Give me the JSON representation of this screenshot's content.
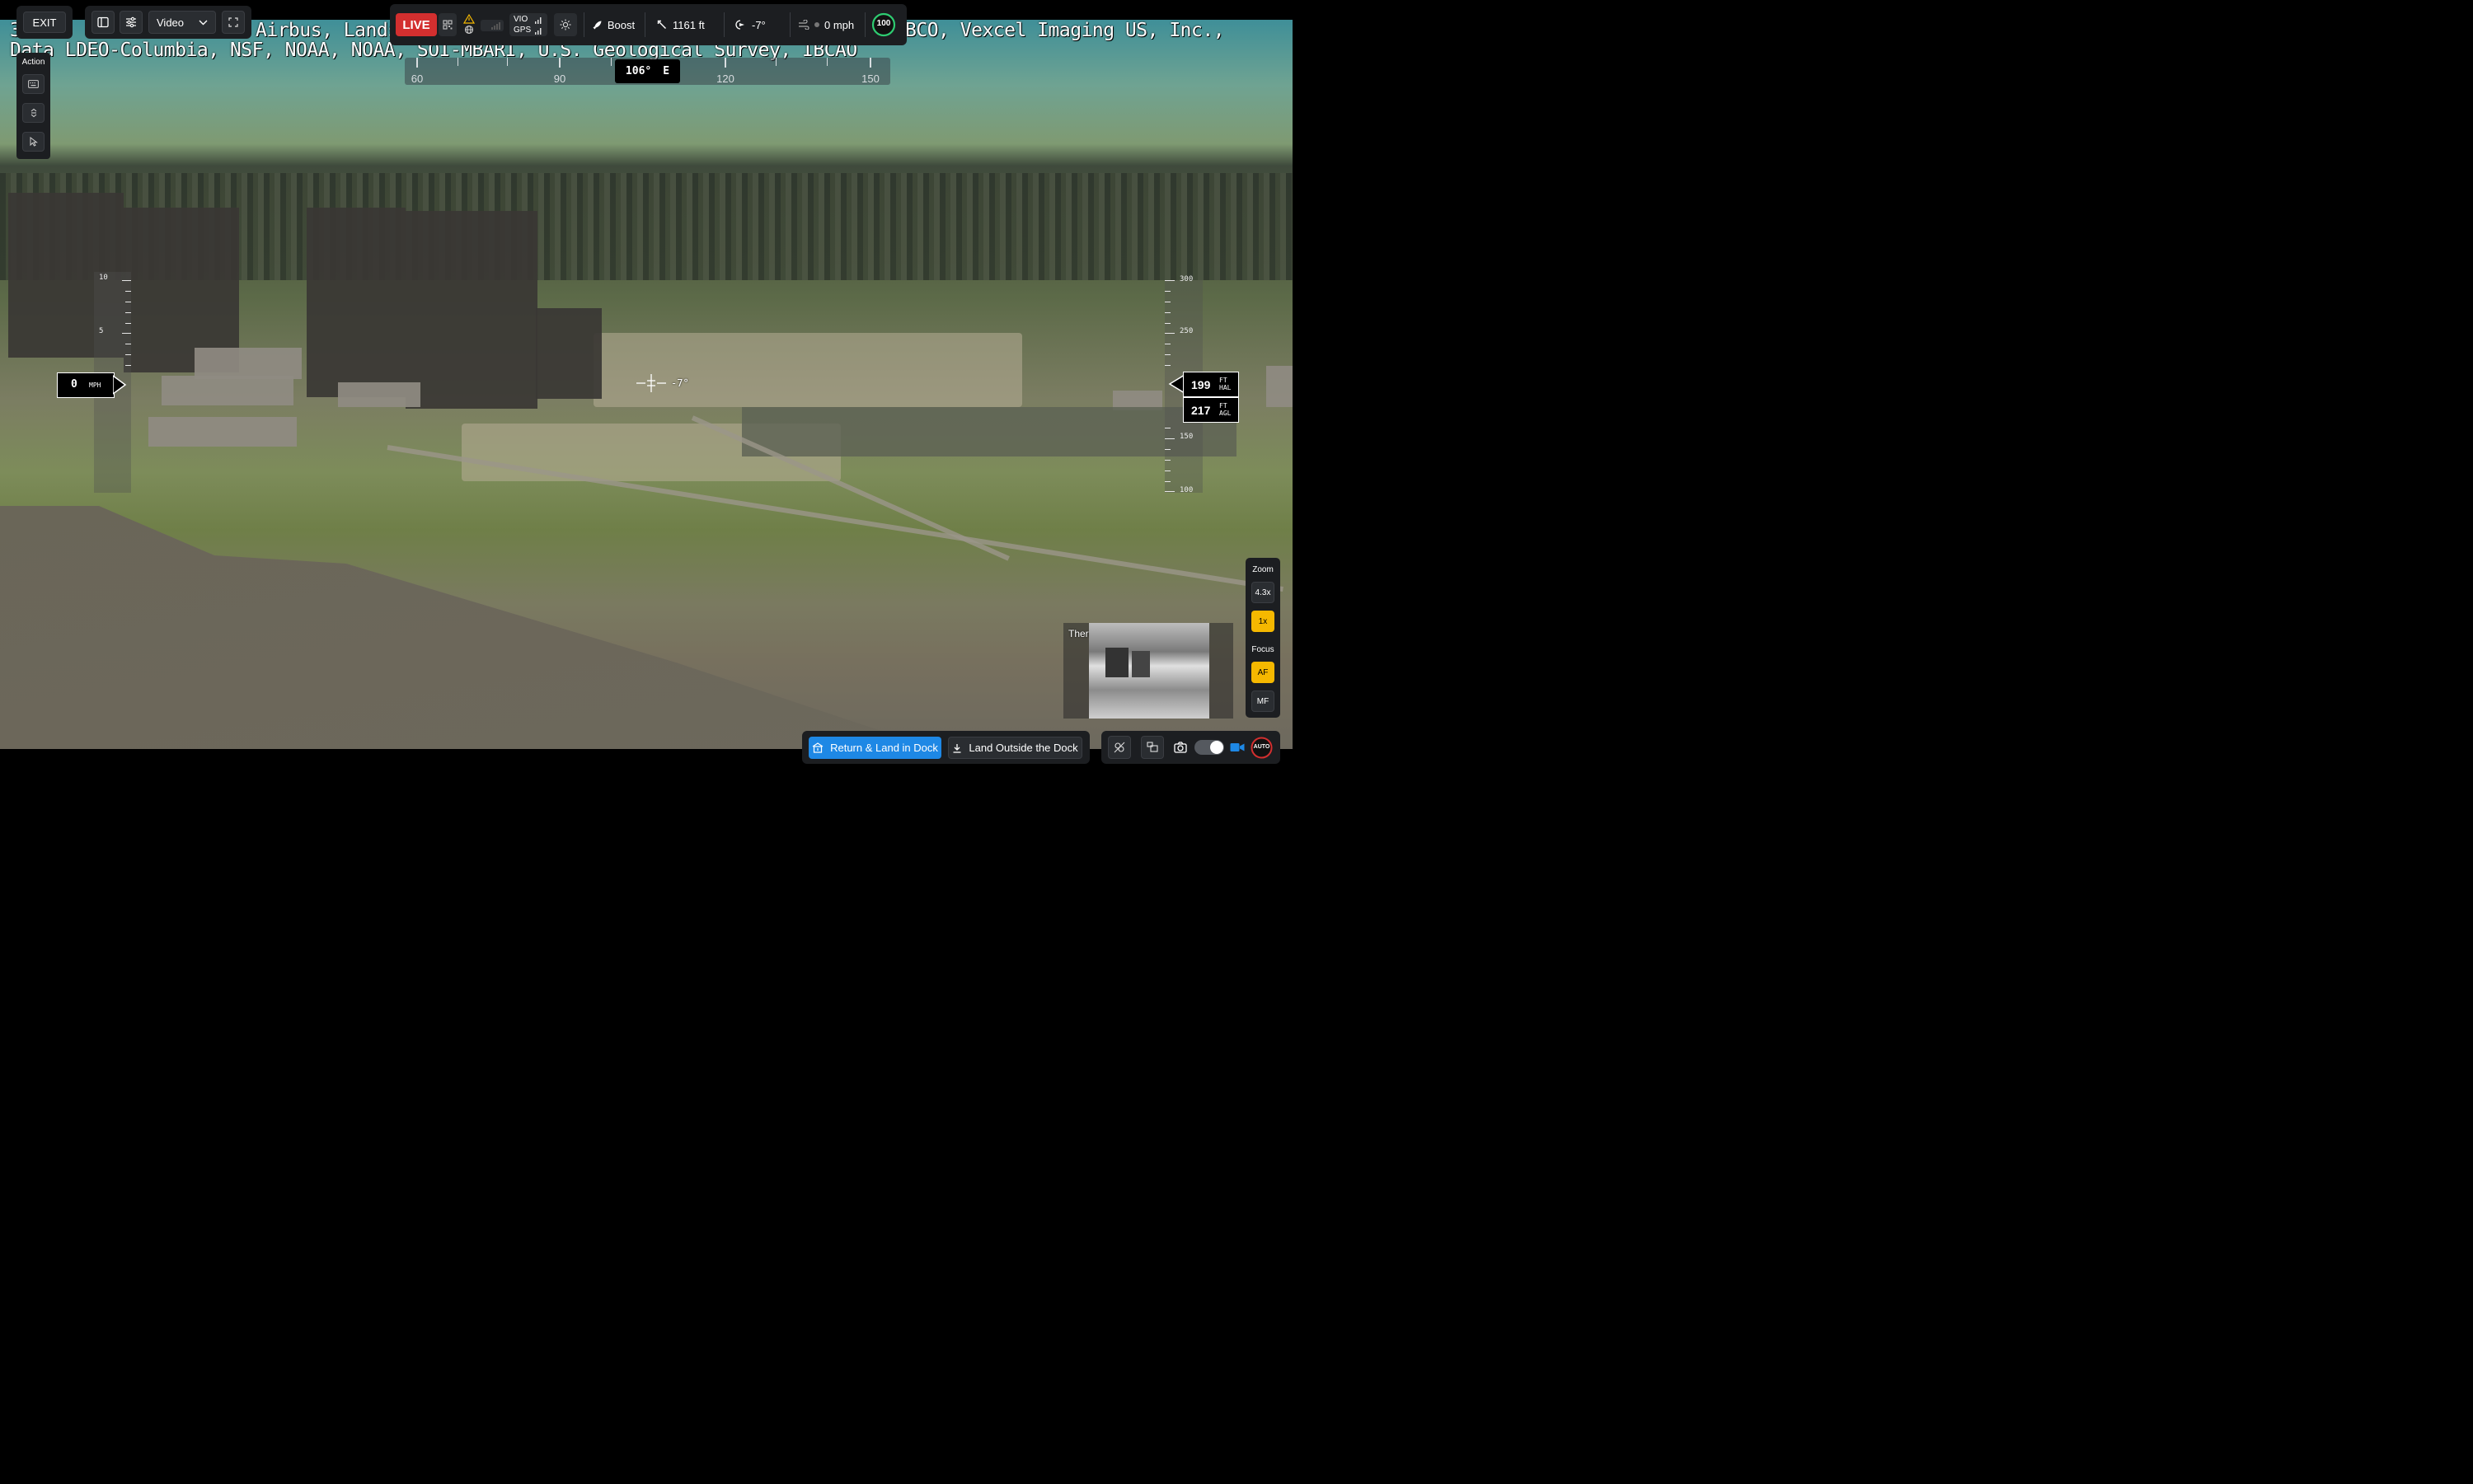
{
  "attribution": {
    "line1_left": "3",
    "line1_mid": "Airbus, Landsat",
    "line1_right": "BCO, Vexcel Imaging US, Inc.,",
    "line2": "Data LDEO-Columbia, NSF, NOAA, NOAA, SOI-MBARI, U.S. Geological Survey, IBCAO"
  },
  "toolbar": {
    "exit_label": "EXIT",
    "video_mode_label": "Video"
  },
  "status": {
    "live_label": "LIVE",
    "vio_label": "VIO",
    "gps_label": "GPS",
    "boost_label": "Boost",
    "distance": "1161 ft",
    "pitch": "-7°",
    "wind": "0 mph",
    "battery": "100"
  },
  "compass": {
    "ticks": [
      "60",
      "90",
      "120",
      "150"
    ],
    "heading_value": "106°",
    "heading_dir": "E"
  },
  "action_panel": {
    "title": "Action"
  },
  "speed": {
    "value": "0",
    "unit": "MPH",
    "scale": [
      "10",
      "5"
    ]
  },
  "altitude": {
    "hal_value": "199",
    "hal_unit_top": "FT",
    "hal_unit_bottom": "HAL",
    "agl_value": "217",
    "agl_unit_top": "FT",
    "agl_unit_bottom": "AGL",
    "scale": [
      "300",
      "250",
      "150",
      "100"
    ]
  },
  "reticle": {
    "pitch_label": "-7°"
  },
  "thermal": {
    "label": "Thermal"
  },
  "zoom_panel": {
    "zoom_title": "Zoom",
    "zoom_options": [
      "4.3x",
      "1x"
    ],
    "focus_title": "Focus",
    "focus_options": [
      "AF",
      "MF"
    ]
  },
  "bottom": {
    "return_label": "Return & Land in Dock",
    "land_label": "Land Outside the Dock",
    "auto_label": "AUTO"
  },
  "colors": {
    "live": "#d32f2f",
    "accent_blue": "#1e88e5",
    "accent_yellow": "#f5b800",
    "battery_green": "#2ecc71"
  }
}
